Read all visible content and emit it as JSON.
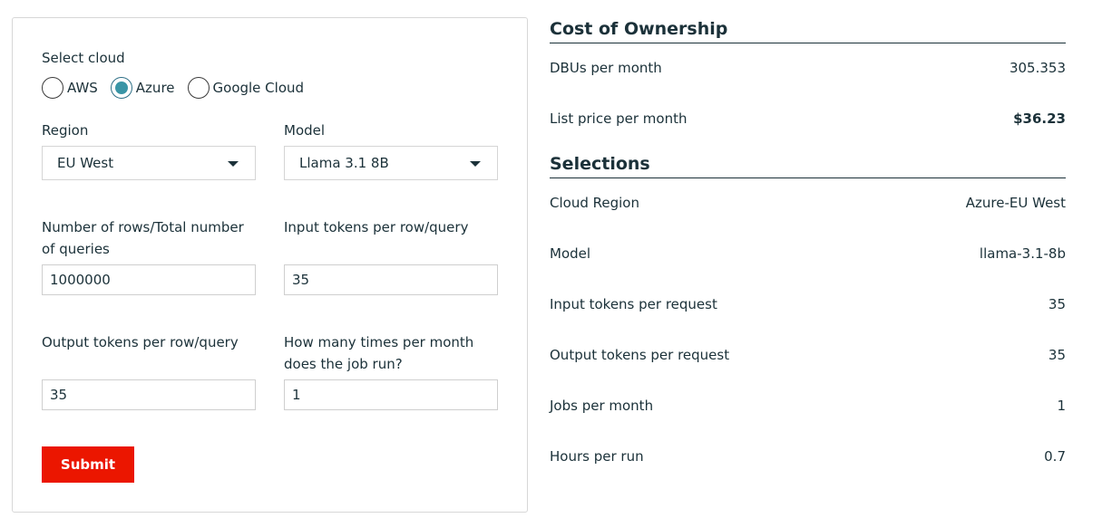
{
  "form": {
    "cloud_label": "Select cloud",
    "cloud_options": [
      {
        "label": "AWS",
        "checked": false
      },
      {
        "label": "Azure",
        "checked": true
      },
      {
        "label": "Google Cloud",
        "checked": false
      }
    ],
    "region_label": "Region",
    "region_value": "EU West",
    "model_label": "Model",
    "model_value": "Llama 3.1 8B",
    "rows_label_line1": "Number of rows/Total number",
    "rows_label_line2": "of queries",
    "rows_value": "1000000",
    "input_tokens_label": "Input tokens per row/query",
    "input_tokens_value": "35",
    "output_tokens_label": "Output tokens per row/query",
    "output_tokens_value": "35",
    "runs_label_line1": "How many times per month",
    "runs_label_line2": "does the job run?",
    "runs_value": "1",
    "submit_label": "Submit"
  },
  "cost": {
    "title": "Cost of Ownership",
    "rows": [
      {
        "key": "DBUs per month",
        "value": "305.353"
      },
      {
        "key": "List price per month",
        "value": "$36.23"
      }
    ]
  },
  "selections": {
    "title": "Selections",
    "rows": [
      {
        "key": "Cloud Region",
        "value": "Azure-EU West"
      },
      {
        "key": "Model",
        "value": "llama-3.1-8b"
      },
      {
        "key": "Input tokens per request",
        "value": "35"
      },
      {
        "key": "Output tokens per request",
        "value": "35"
      },
      {
        "key": "Jobs per month",
        "value": "1"
      },
      {
        "key": "Hours per run",
        "value": "0.7"
      }
    ]
  },
  "colors": {
    "accent": "#3a95a6",
    "submit": "#eb1600",
    "text": "#1b3139"
  }
}
